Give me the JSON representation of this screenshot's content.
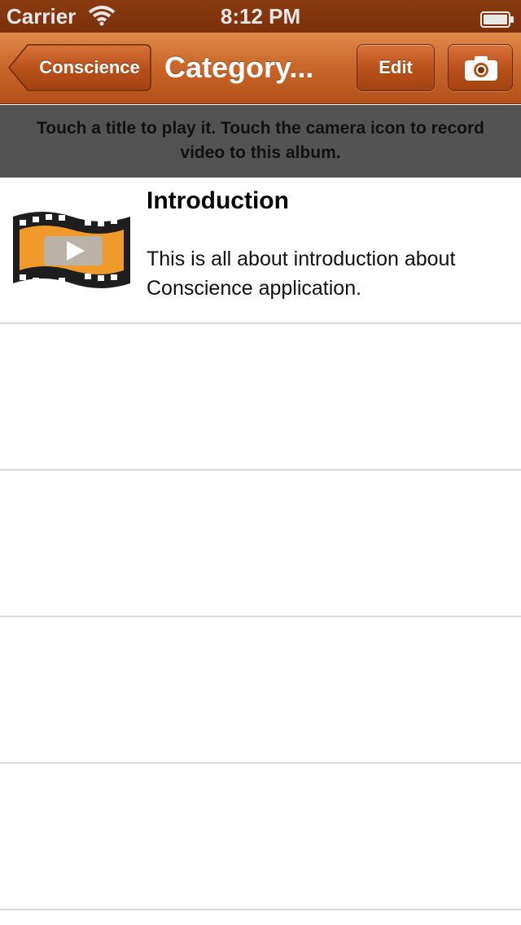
{
  "status_bar": {
    "carrier": "Carrier",
    "time": "8:12 PM",
    "icons": [
      "wifi-icon",
      "battery-icon"
    ]
  },
  "nav_bar": {
    "back_label": "Conscience",
    "title": "Category...",
    "edit_label": "Edit",
    "camera_icon": "camera-icon",
    "colors": {
      "bar": "#c9662a",
      "button": "#b9521b"
    }
  },
  "banner": {
    "text_line1": "Touch a title to play it. Touch the camera icon to record",
    "text_line2": "video to this album."
  },
  "videos": [
    {
      "title": "Introduction",
      "description_line1": "This is all about introduction about",
      "description_line2": "Conscience application.",
      "thumbnail_icon": "film-strip-icon"
    }
  ]
}
